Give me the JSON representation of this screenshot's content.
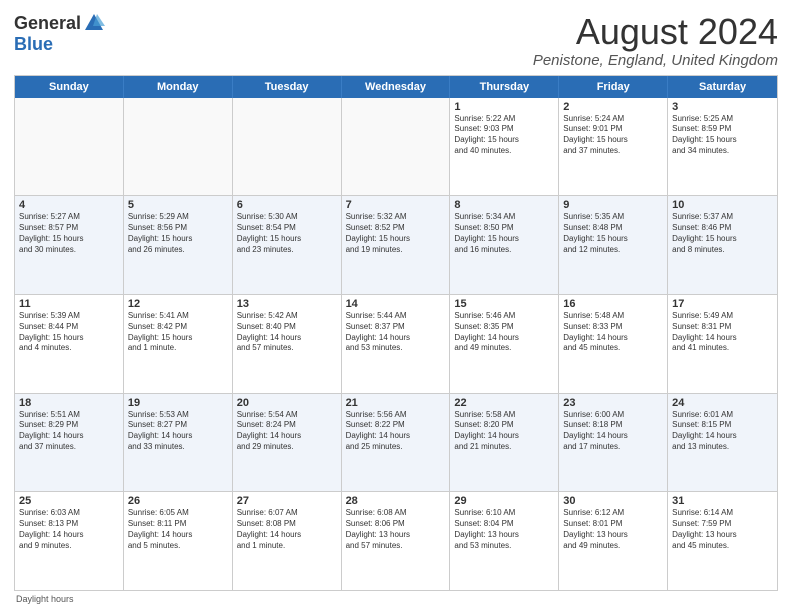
{
  "logo": {
    "general": "General",
    "blue": "Blue"
  },
  "title": "August 2024",
  "location": "Penistone, England, United Kingdom",
  "days": [
    "Sunday",
    "Monday",
    "Tuesday",
    "Wednesday",
    "Thursday",
    "Friday",
    "Saturday"
  ],
  "weeks": [
    [
      {
        "day": "",
        "info": ""
      },
      {
        "day": "",
        "info": ""
      },
      {
        "day": "",
        "info": ""
      },
      {
        "day": "",
        "info": ""
      },
      {
        "day": "1",
        "info": "Sunrise: 5:22 AM\nSunset: 9:03 PM\nDaylight: 15 hours\nand 40 minutes."
      },
      {
        "day": "2",
        "info": "Sunrise: 5:24 AM\nSunset: 9:01 PM\nDaylight: 15 hours\nand 37 minutes."
      },
      {
        "day": "3",
        "info": "Sunrise: 5:25 AM\nSunset: 8:59 PM\nDaylight: 15 hours\nand 34 minutes."
      }
    ],
    [
      {
        "day": "4",
        "info": "Sunrise: 5:27 AM\nSunset: 8:57 PM\nDaylight: 15 hours\nand 30 minutes."
      },
      {
        "day": "5",
        "info": "Sunrise: 5:29 AM\nSunset: 8:56 PM\nDaylight: 15 hours\nand 26 minutes."
      },
      {
        "day": "6",
        "info": "Sunrise: 5:30 AM\nSunset: 8:54 PM\nDaylight: 15 hours\nand 23 minutes."
      },
      {
        "day": "7",
        "info": "Sunrise: 5:32 AM\nSunset: 8:52 PM\nDaylight: 15 hours\nand 19 minutes."
      },
      {
        "day": "8",
        "info": "Sunrise: 5:34 AM\nSunset: 8:50 PM\nDaylight: 15 hours\nand 16 minutes."
      },
      {
        "day": "9",
        "info": "Sunrise: 5:35 AM\nSunset: 8:48 PM\nDaylight: 15 hours\nand 12 minutes."
      },
      {
        "day": "10",
        "info": "Sunrise: 5:37 AM\nSunset: 8:46 PM\nDaylight: 15 hours\nand 8 minutes."
      }
    ],
    [
      {
        "day": "11",
        "info": "Sunrise: 5:39 AM\nSunset: 8:44 PM\nDaylight: 15 hours\nand 4 minutes."
      },
      {
        "day": "12",
        "info": "Sunrise: 5:41 AM\nSunset: 8:42 PM\nDaylight: 15 hours\nand 1 minute."
      },
      {
        "day": "13",
        "info": "Sunrise: 5:42 AM\nSunset: 8:40 PM\nDaylight: 14 hours\nand 57 minutes."
      },
      {
        "day": "14",
        "info": "Sunrise: 5:44 AM\nSunset: 8:37 PM\nDaylight: 14 hours\nand 53 minutes."
      },
      {
        "day": "15",
        "info": "Sunrise: 5:46 AM\nSunset: 8:35 PM\nDaylight: 14 hours\nand 49 minutes."
      },
      {
        "day": "16",
        "info": "Sunrise: 5:48 AM\nSunset: 8:33 PM\nDaylight: 14 hours\nand 45 minutes."
      },
      {
        "day": "17",
        "info": "Sunrise: 5:49 AM\nSunset: 8:31 PM\nDaylight: 14 hours\nand 41 minutes."
      }
    ],
    [
      {
        "day": "18",
        "info": "Sunrise: 5:51 AM\nSunset: 8:29 PM\nDaylight: 14 hours\nand 37 minutes."
      },
      {
        "day": "19",
        "info": "Sunrise: 5:53 AM\nSunset: 8:27 PM\nDaylight: 14 hours\nand 33 minutes."
      },
      {
        "day": "20",
        "info": "Sunrise: 5:54 AM\nSunset: 8:24 PM\nDaylight: 14 hours\nand 29 minutes."
      },
      {
        "day": "21",
        "info": "Sunrise: 5:56 AM\nSunset: 8:22 PM\nDaylight: 14 hours\nand 25 minutes."
      },
      {
        "day": "22",
        "info": "Sunrise: 5:58 AM\nSunset: 8:20 PM\nDaylight: 14 hours\nand 21 minutes."
      },
      {
        "day": "23",
        "info": "Sunrise: 6:00 AM\nSunset: 8:18 PM\nDaylight: 14 hours\nand 17 minutes."
      },
      {
        "day": "24",
        "info": "Sunrise: 6:01 AM\nSunset: 8:15 PM\nDaylight: 14 hours\nand 13 minutes."
      }
    ],
    [
      {
        "day": "25",
        "info": "Sunrise: 6:03 AM\nSunset: 8:13 PM\nDaylight: 14 hours\nand 9 minutes."
      },
      {
        "day": "26",
        "info": "Sunrise: 6:05 AM\nSunset: 8:11 PM\nDaylight: 14 hours\nand 5 minutes."
      },
      {
        "day": "27",
        "info": "Sunrise: 6:07 AM\nSunset: 8:08 PM\nDaylight: 14 hours\nand 1 minute."
      },
      {
        "day": "28",
        "info": "Sunrise: 6:08 AM\nSunset: 8:06 PM\nDaylight: 13 hours\nand 57 minutes."
      },
      {
        "day": "29",
        "info": "Sunrise: 6:10 AM\nSunset: 8:04 PM\nDaylight: 13 hours\nand 53 minutes."
      },
      {
        "day": "30",
        "info": "Sunrise: 6:12 AM\nSunset: 8:01 PM\nDaylight: 13 hours\nand 49 minutes."
      },
      {
        "day": "31",
        "info": "Sunrise: 6:14 AM\nSunset: 7:59 PM\nDaylight: 13 hours\nand 45 minutes."
      }
    ]
  ],
  "footer": "Daylight hours"
}
